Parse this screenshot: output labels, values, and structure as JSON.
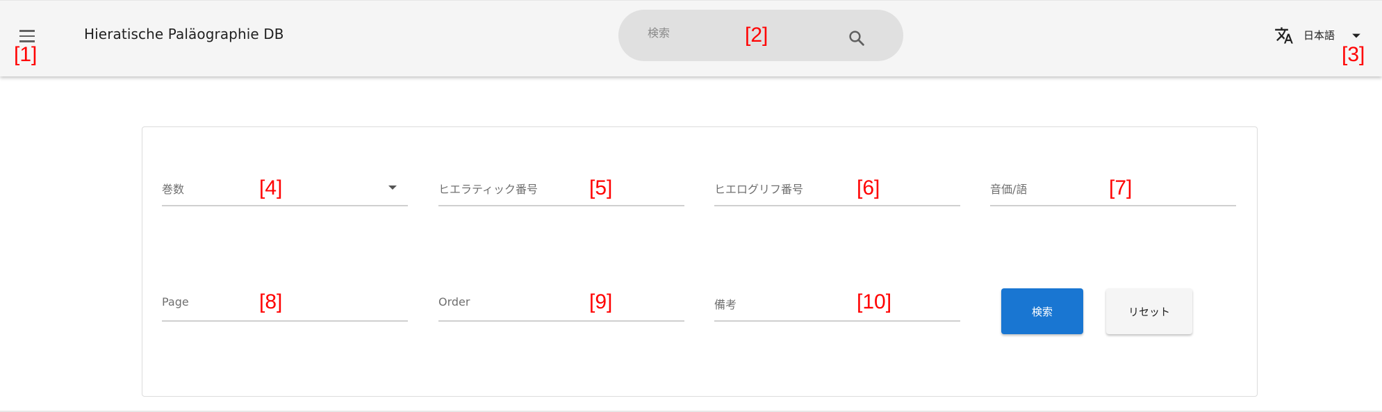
{
  "appbar": {
    "title": "Hieratische Paläographie DB",
    "search_placeholder": "検索",
    "language_label": "日本語",
    "icons": {
      "menu": "menu-icon",
      "search": "search-icon",
      "translate": "translate-icon",
      "dropdown": "arrow-drop-down-icon"
    }
  },
  "form": {
    "fields": {
      "volume": {
        "label": "巻数",
        "value": ""
      },
      "hieratic_number": {
        "label": "ヒエラティック番号",
        "value": ""
      },
      "hieroglyph_number": {
        "label": "ヒエログリフ番号",
        "value": ""
      },
      "phonetic_word": {
        "label": "音価/語",
        "value": ""
      },
      "page": {
        "label": "Page",
        "value": ""
      },
      "order": {
        "label": "Order",
        "value": ""
      },
      "notes": {
        "label": "備考",
        "value": ""
      }
    },
    "search_button": "検索",
    "reset_button": "リセット"
  },
  "markers": [
    "[1]",
    "[2]",
    "[3]",
    "[4]",
    "[5]",
    "[6]",
    "[7]",
    "[8]",
    "[9]",
    "[10]"
  ],
  "colors": {
    "primary": "#1976d2",
    "appbar_bg": "#f5f5f5",
    "search_bg": "#e0e0e0",
    "marker": "#ff0000"
  }
}
